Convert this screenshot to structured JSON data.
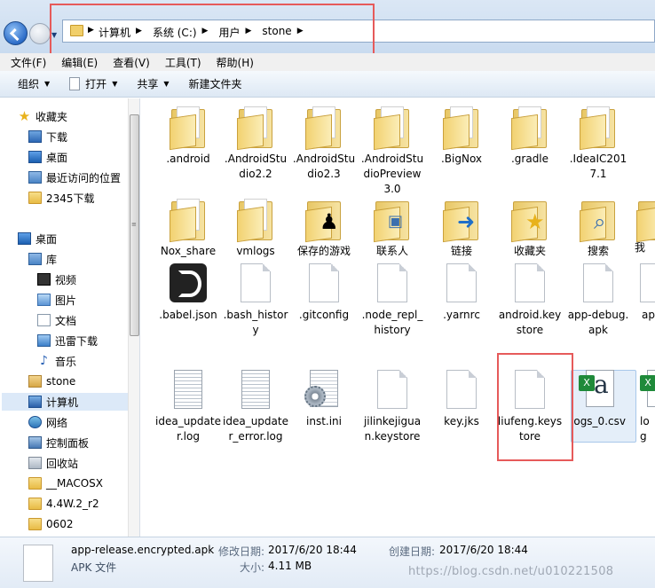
{
  "address": {
    "crumbs": [
      "计算机",
      "系统 (C:)",
      "用户",
      "stone"
    ]
  },
  "menu": [
    "文件(F)",
    "编辑(E)",
    "查看(V)",
    "工具(T)",
    "帮助(H)"
  ],
  "toolbar": {
    "organize": "组织",
    "open": "打开",
    "share": "共享",
    "new_folder": "新建文件夹"
  },
  "sidebar": {
    "items": [
      {
        "label": "收藏夹",
        "icon": "star-icon"
      },
      {
        "label": "下载",
        "icon": "download-folder-icon"
      },
      {
        "label": "桌面",
        "icon": "desktop-icon"
      },
      {
        "label": "最近访问的位置",
        "icon": "recent-places-icon"
      },
      {
        "label": "2345下载",
        "icon": "folder-icon"
      },
      {
        "label": "桌面",
        "icon": "desktop-icon"
      },
      {
        "label": "库",
        "icon": "library-icon"
      },
      {
        "label": "视频",
        "icon": "video-icon"
      },
      {
        "label": "图片",
        "icon": "picture-icon"
      },
      {
        "label": "文档",
        "icon": "document-icon"
      },
      {
        "label": "迅雷下载",
        "icon": "thunder-download-icon"
      },
      {
        "label": "音乐",
        "icon": "music-icon"
      },
      {
        "label": "stone",
        "icon": "user-folder-icon"
      },
      {
        "label": "计算机",
        "icon": "computer-icon"
      },
      {
        "label": "网络",
        "icon": "network-icon"
      },
      {
        "label": "控制面板",
        "icon": "control-panel-icon"
      },
      {
        "label": "回收站",
        "icon": "recycle-bin-icon"
      },
      {
        "label": "__MACOSX",
        "icon": "folder-icon"
      },
      {
        "label": "4.4W.2_r2",
        "icon": "folder-icon"
      },
      {
        "label": "0602",
        "icon": "folder-icon"
      }
    ]
  },
  "files": [
    {
      "name": ".android",
      "kind": "folder"
    },
    {
      "name": ".AndroidStudio2.2",
      "kind": "folder"
    },
    {
      "name": ".AndroidStudio2.3",
      "kind": "folder"
    },
    {
      "name": ".AndroidStudioPreview3.0",
      "kind": "folder"
    },
    {
      "name": ".BigNox",
      "kind": "folder"
    },
    {
      "name": ".gradle",
      "kind": "folder"
    },
    {
      "name": ".IdeaIC2017.1",
      "kind": "folder"
    },
    {
      "name": "Nox_share",
      "kind": "folder"
    },
    {
      "name": "vmlogs",
      "kind": "folder"
    },
    {
      "name": "保存的游戏",
      "kind": "folder"
    },
    {
      "name": "联系人",
      "kind": "folder"
    },
    {
      "name": "链接",
      "kind": "folder"
    },
    {
      "name": "收藏夹",
      "kind": "folder"
    },
    {
      "name": "搜索",
      "kind": "folder"
    },
    {
      "name": "我",
      "kind": "folder"
    },
    {
      "name": ".babel.json",
      "kind": "file"
    },
    {
      "name": ".bash_history",
      "kind": "file"
    },
    {
      "name": ".gitconfig",
      "kind": "file"
    },
    {
      "name": ".node_repl_history",
      "kind": "file"
    },
    {
      "name": ".yarnrc",
      "kind": "file"
    },
    {
      "name": "android.keystore",
      "kind": "file"
    },
    {
      "name": "app-debug.apk",
      "kind": "file"
    },
    {
      "name": "ap",
      "kind": "file"
    },
    {
      "name": "idea_updater.log",
      "kind": "file"
    },
    {
      "name": "idea_updater_error.log",
      "kind": "file"
    },
    {
      "name": "inst.ini",
      "kind": "file"
    },
    {
      "name": "jilinkejiguan.keystore",
      "kind": "file"
    },
    {
      "name": "key.jks",
      "kind": "file"
    },
    {
      "name": "liufeng.keystore",
      "kind": "file"
    },
    {
      "name": "logs_0.csv",
      "kind": "file"
    },
    {
      "name": "log",
      "kind": "file"
    }
  ],
  "details": {
    "name": "app-release.encrypted.apk",
    "type": "APK 文件",
    "modified_label": "修改日期:",
    "modified_value": "2017/6/20 18:44",
    "created_label": "创建日期:",
    "created_value": "2017/6/20 18:44",
    "size_label": "大小:",
    "size_value": "4.11 MB"
  },
  "watermark": "https://blog.csdn.net/u010221508"
}
